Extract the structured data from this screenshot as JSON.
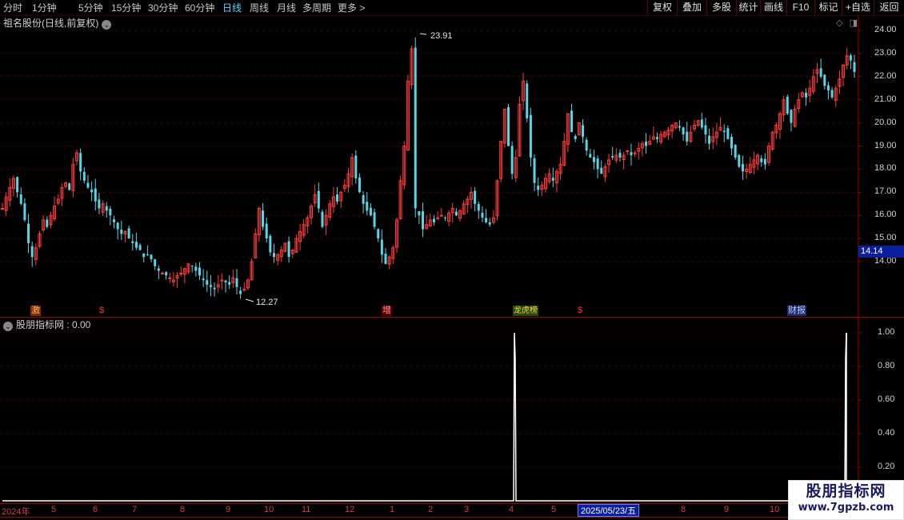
{
  "toolbar": {
    "periods": [
      "分时",
      "1分钟",
      "5分钟",
      "15分钟",
      "30分钟",
      "60分钟",
      "日线",
      "周线",
      "月线",
      "多周期",
      "更多 >"
    ],
    "active_period": "日线",
    "right_buttons": [
      "复权",
      "叠加",
      "多股",
      "统计",
      "画线",
      "F10",
      "标记",
      "+自选",
      "返回"
    ]
  },
  "main_chart": {
    "title": "祖名股份(日线,前复权)",
    "y_ticks": [
      "24.00",
      "23.00",
      "22.00",
      "21.00",
      "20.00",
      "19.00",
      "18.00",
      "17.00",
      "16.00",
      "15.00",
      "14.00"
    ],
    "current_price": "14.14",
    "high_label": "23.91",
    "low_label": "12.27",
    "event_tags": [
      {
        "text": "激",
        "color": "#ff7a1a"
      },
      {
        "text": "$",
        "color": "#ff3030"
      },
      {
        "text": "增",
        "color": "#ff7a7a"
      },
      {
        "text": "龙虎榜",
        "color": "#f0c040"
      },
      {
        "text": "$",
        "color": "#ff3030"
      },
      {
        "text": "财报",
        "color": "#9bb0ff"
      }
    ]
  },
  "indicator": {
    "title": "股朋指标网 : 0.00",
    "y_ticks": [
      "1.00",
      "0.80",
      "0.60",
      "0.40",
      "0.20"
    ]
  },
  "date_axis": {
    "labels": [
      "2024年",
      "5",
      "6",
      "7",
      "8",
      "9",
      "10",
      "11",
      "12",
      "1",
      "2",
      "3",
      "4",
      "5",
      "8",
      "9",
      "10"
    ],
    "cursor_date": "2025/05/23/五"
  },
  "watermark": {
    "line1": "股朋指标网",
    "line2": "www.7gpzb.com"
  },
  "colors": {
    "up": "#ff3c3c",
    "down": "#54d7e6",
    "grid": "#7a0000",
    "axis": "#a00000"
  },
  "chart_data": {
    "type": "candlestick",
    "ylim": [
      12.0,
      24.3
    ],
    "closes": [
      16.3,
      16.8,
      17.2,
      17.6,
      17.0,
      16.5,
      15.8,
      14.8,
      14.2,
      14.6,
      15.2,
      15.8,
      15.5,
      16.0,
      16.4,
      16.7,
      17.2,
      17.4,
      17.1,
      18.2,
      18.7,
      17.9,
      17.5,
      17.2,
      17.0,
      16.6,
      16.3,
      16.5,
      16.2,
      16.0,
      15.7,
      15.4,
      15.2,
      15.3,
      15.0,
      14.8,
      14.6,
      14.5,
      14.2,
      14.3,
      14.1,
      13.8,
      13.6,
      13.5,
      13.4,
      13.3,
      13.2,
      13.4,
      13.5,
      13.7,
      13.9,
      13.8,
      13.6,
      13.4,
      13.2,
      13.0,
      12.9,
      12.8,
      13.0,
      13.2,
      13.1,
      13.0,
      13.3,
      12.9,
      12.6,
      12.8,
      13.2,
      14.0,
      15.2,
      16.3,
      15.5,
      15.0,
      14.4,
      14.2,
      14.3,
      14.5,
      14.8,
      14.2,
      14.5,
      15.0,
      15.3,
      15.6,
      15.9,
      16.4,
      16.9,
      16.3,
      15.5,
      16.0,
      16.5,
      16.8,
      16.6,
      17.0,
      17.3,
      17.8,
      18.5,
      17.6,
      17.0,
      16.5,
      16.2,
      16.0,
      15.5,
      15.0,
      14.3,
      13.9,
      14.2,
      14.6,
      15.8,
      17.5,
      19.0,
      21.8,
      23.2,
      16.3,
      16.0,
      15.4,
      15.6,
      15.8,
      15.7,
      15.9,
      16.0,
      15.9,
      16.1,
      16.3,
      16.0,
      16.2,
      16.5,
      16.7,
      17.0,
      16.5,
      16.2,
      15.9,
      15.7,
      15.6,
      15.9,
      17.5,
      19.2,
      20.6,
      19.0,
      17.8,
      18.5,
      20.8,
      21.8,
      20.2,
      18.5,
      17.4,
      17.1,
      17.3,
      17.6,
      17.8,
      17.5,
      17.9,
      18.2,
      19.2,
      20.4,
      19.6,
      19.3,
      20.0,
      19.4,
      18.8,
      18.5,
      18.3,
      18.0,
      17.8,
      18.1,
      18.4,
      18.5,
      18.6,
      18.5,
      18.6,
      18.8,
      18.6,
      18.7,
      18.9,
      19.1,
      19.0,
      19.2,
      19.4,
      19.3,
      19.5,
      19.6,
      19.7,
      19.9,
      20.0,
      19.8,
      19.5,
      19.2,
      19.6,
      19.9,
      20.1,
      19.8,
      19.5,
      19.1,
      19.4,
      19.6,
      19.8,
      19.6,
      19.3,
      18.9,
      18.5,
      18.1,
      17.9,
      18.0,
      18.2,
      18.4,
      18.6,
      18.3,
      18.2,
      19.0,
      19.6,
      19.9,
      20.4,
      21.0,
      20.4,
      20.0,
      20.6,
      21.0,
      21.3,
      21.1,
      21.5,
      22.0,
      22.3,
      22.0,
      21.6,
      21.4,
      21.1,
      21.5,
      21.9,
      22.5,
      22.9,
      22.7,
      22.2
    ]
  }
}
